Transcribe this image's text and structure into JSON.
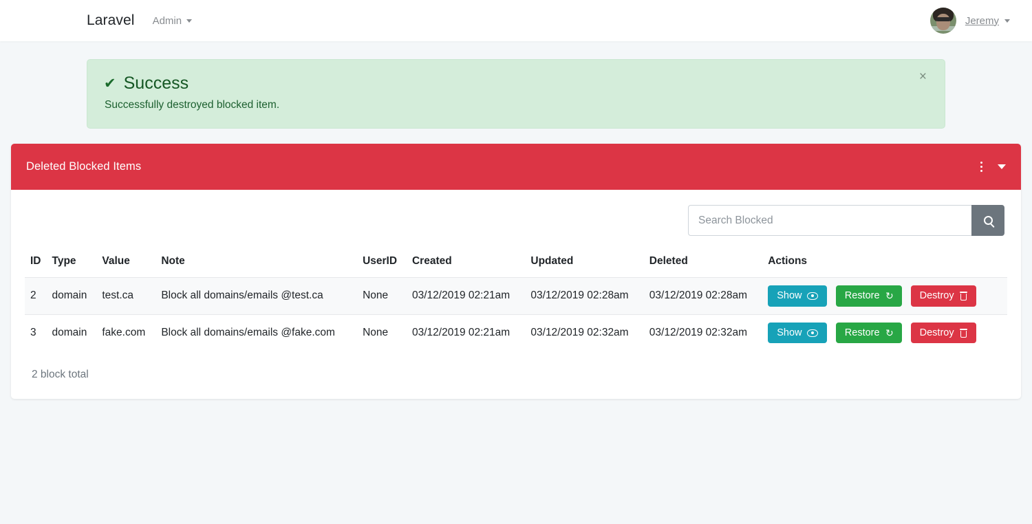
{
  "navbar": {
    "brand": "Laravel",
    "admin_label": "Admin",
    "user_name": "Jeremy",
    "avatar_icon": "user-avatar",
    "caret_icon": "caret-down-icon"
  },
  "alert": {
    "icon": "check-icon",
    "icon_glyph": "✔",
    "title": "Success",
    "message": "Successfully destroyed blocked item.",
    "close_label": "×",
    "bg_color": "#d4edda",
    "text_color": "#155724"
  },
  "card": {
    "title": "Deleted Blocked Items",
    "header_color": "#dc3545",
    "tools": {
      "menu_icon": "vertical-dots-icon",
      "collapse_icon": "caret-down-icon"
    }
  },
  "search": {
    "placeholder": "Search Blocked",
    "value": "",
    "button_icon": "search-icon",
    "button_color": "#6c757d"
  },
  "table": {
    "columns": [
      "ID",
      "Type",
      "Value",
      "Note",
      "UserID",
      "Created",
      "Updated",
      "Deleted",
      "Actions"
    ],
    "rows": [
      {
        "id": "2",
        "type": "domain",
        "value": "test.ca",
        "note": "Block all domains/emails @test.ca",
        "userid": "None",
        "created": "03/12/2019 02:21am",
        "updated": "03/12/2019 02:28am",
        "deleted": "03/12/2019 02:28am"
      },
      {
        "id": "3",
        "type": "domain",
        "value": "fake.com",
        "note": "Block all domains/emails @fake.com",
        "userid": "None",
        "created": "03/12/2019 02:21am",
        "updated": "03/12/2019 02:32am",
        "deleted": "03/12/2019 02:32am"
      }
    ],
    "actions": {
      "show_label": "Show",
      "show_icon": "eye-icon",
      "show_color": "#17a2b8",
      "restore_label": "Restore",
      "restore_icon": "undo-icon",
      "restore_glyph": "↺",
      "restore_color": "#28a745",
      "destroy_label": "Destroy",
      "destroy_icon": "trash-icon",
      "destroy_color": "#dc3545"
    },
    "total_text": "2 block total"
  }
}
